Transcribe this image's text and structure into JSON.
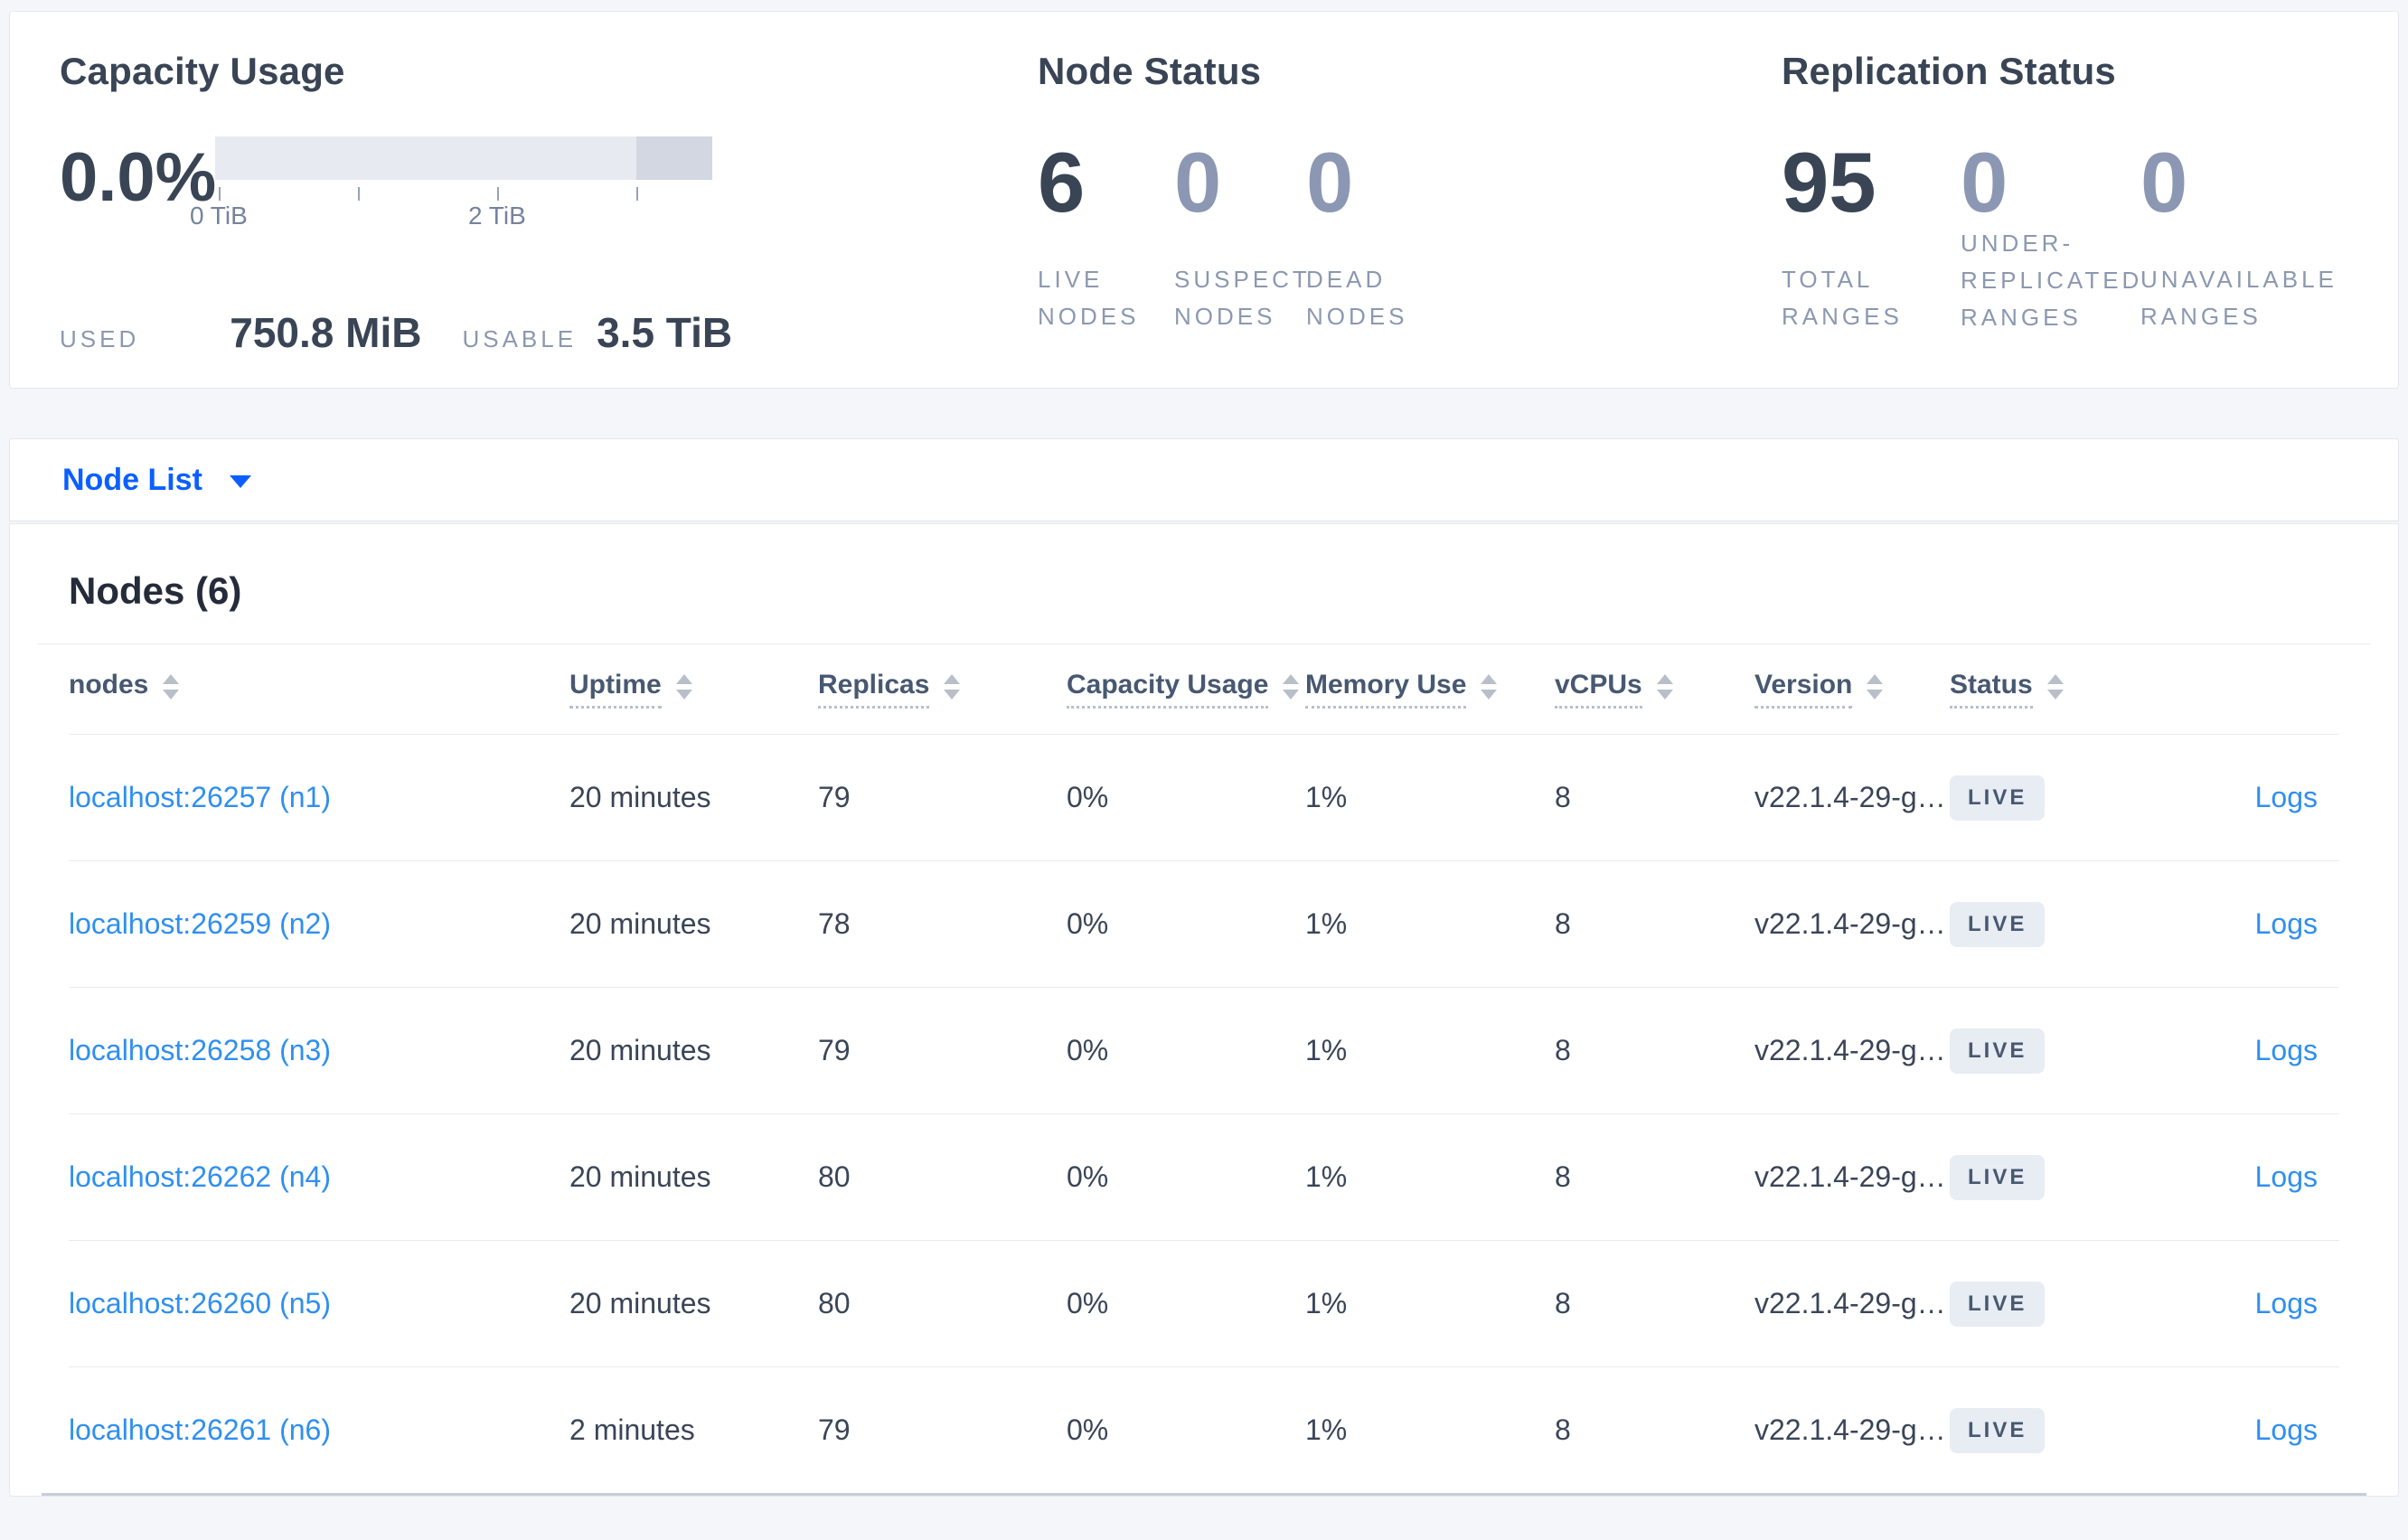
{
  "summary": {
    "capacity": {
      "title": "Capacity Usage",
      "percent": "0.0%",
      "used_label": "USED",
      "used_value": "750.8 MiB",
      "usable_label": "USABLE",
      "usable_value": "3.5 TiB",
      "axis_labels": [
        "0 TiB",
        "2 TiB"
      ],
      "bar": {
        "light_color": "#e8eaf1",
        "dark_color": "#d2d7e1",
        "dark_segment_start_pct": 84.7,
        "tick_positions_pct": [
          0.7,
          28.7,
          56.7,
          84.7
        ]
      }
    },
    "node_status": {
      "title": "Node Status",
      "stats": [
        {
          "value": "6",
          "label": "LIVE NODES"
        },
        {
          "value": "0",
          "label": "SUSPECT NODES"
        },
        {
          "value": "0",
          "label": "DEAD NODES"
        }
      ]
    },
    "replication": {
      "title": "Replication Status",
      "stats": [
        {
          "value": "95",
          "label": "TOTAL RANGES"
        },
        {
          "value": "0",
          "label": "UNDER-REPLICATED RANGES"
        },
        {
          "value": "0",
          "label": "UNAVAILABLE RANGES"
        }
      ]
    }
  },
  "node_list": {
    "label": "Node List"
  },
  "nodes": {
    "heading": "Nodes (6)",
    "columns": [
      "nodes",
      "Uptime",
      "Replicas",
      "Capacity Usage",
      "Memory Use",
      "vCPUs",
      "Version",
      "Status"
    ],
    "logs_label": "Logs",
    "rows": [
      {
        "name": "localhost:26257 (n1)",
        "uptime": "20 minutes",
        "replicas": "79",
        "capacity": "0%",
        "memory": "1%",
        "vcpus": "8",
        "version": "v22.1.4-29-g…",
        "status": "LIVE"
      },
      {
        "name": "localhost:26259 (n2)",
        "uptime": "20 minutes",
        "replicas": "78",
        "capacity": "0%",
        "memory": "1%",
        "vcpus": "8",
        "version": "v22.1.4-29-g…",
        "status": "LIVE"
      },
      {
        "name": "localhost:26258 (n3)",
        "uptime": "20 minutes",
        "replicas": "79",
        "capacity": "0%",
        "memory": "1%",
        "vcpus": "8",
        "version": "v22.1.4-29-g…",
        "status": "LIVE"
      },
      {
        "name": "localhost:26262 (n4)",
        "uptime": "20 minutes",
        "replicas": "80",
        "capacity": "0%",
        "memory": "1%",
        "vcpus": "8",
        "version": "v22.1.4-29-g…",
        "status": "LIVE"
      },
      {
        "name": "localhost:26260 (n5)",
        "uptime": "20 minutes",
        "replicas": "80",
        "capacity": "0%",
        "memory": "1%",
        "vcpus": "8",
        "version": "v22.1.4-29-g…",
        "status": "LIVE"
      },
      {
        "name": "localhost:26261 (n6)",
        "uptime": "2 minutes",
        "replicas": "79",
        "capacity": "0%",
        "memory": "1%",
        "vcpus": "8",
        "version": "v22.1.4-29-g…",
        "status": "LIVE"
      }
    ]
  }
}
